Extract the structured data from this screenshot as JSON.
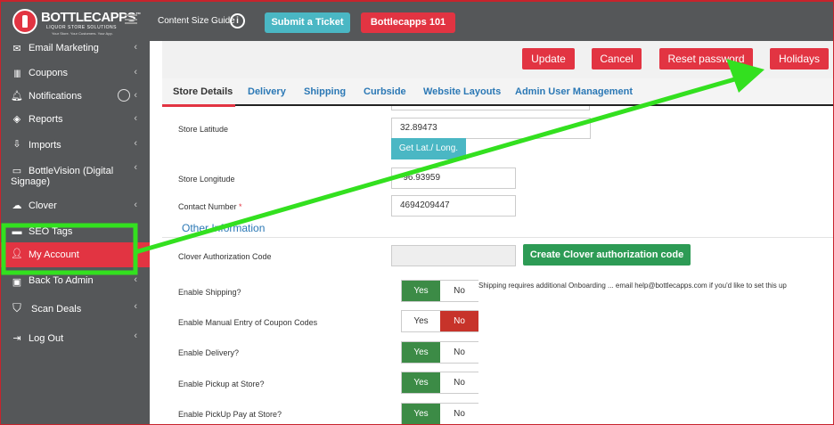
{
  "brand": {
    "name": "BOTTLECAPPS",
    "trademark": "™",
    "tagline": "LIQUOR STORE SOLUTIONS",
    "subtagline": "Your Store. Your Customers. Your App."
  },
  "topbar": {
    "content_size_guide": "Content Size Guide",
    "info": "i",
    "submit_ticket": "Submit a Ticket",
    "bottlecapps_101": "Bottlecapps 101"
  },
  "sidebar": {
    "items": [
      {
        "label": "Email Marketing",
        "icon": "envelope-icon"
      },
      {
        "label": "Coupons",
        "icon": "barcode-icon"
      },
      {
        "label": "Notifications",
        "icon": "bell-icon"
      },
      {
        "label": "Reports",
        "icon": "layers-icon"
      },
      {
        "label": "Imports",
        "icon": "import-icon"
      },
      {
        "label": "BottleVision (Digital Signage)",
        "icon": "monitor-icon"
      },
      {
        "label": "Clover",
        "icon": "cloud-icon"
      },
      {
        "label": "SEO Tags",
        "icon": "tag-icon"
      },
      {
        "label": "My Account",
        "icon": "user-icon"
      },
      {
        "label": "Back To Admin",
        "icon": "admin-icon"
      },
      {
        "label": "Scan Deals",
        "icon": "tags-icon"
      },
      {
        "label": "Log Out",
        "icon": "logout-icon"
      }
    ],
    "active": "My Account"
  },
  "actions": {
    "update": "Update",
    "cancel": "Cancel",
    "reset_password": "Reset password",
    "holidays": "Holidays"
  },
  "tabs": [
    "Store Details",
    "Delivery",
    "Shipping",
    "Curbside",
    "Website Layouts",
    "Admin User Management"
  ],
  "active_tab": "Store Details",
  "form": {
    "store_latitude_label": "Store Latitude",
    "store_latitude_value": "32.89473",
    "get_lat_long": "Get Lat./ Long.",
    "store_longitude_label": "Store Longitude",
    "store_longitude_value": "-96.93959",
    "contact_number_label": "Contact Number",
    "contact_number_required": "*",
    "contact_number_value": "4694209447",
    "other_information": "Other Information",
    "clover_auth_label": "Clover Authorization Code",
    "clover_auth_value": "",
    "create_clover_button": "Create Clover authorization code",
    "toggles": [
      {
        "label": "Enable Shipping?",
        "value": "Yes"
      },
      {
        "label": "Enable Manual Entry of Coupon Codes",
        "value": "No"
      },
      {
        "label": "Enable Delivery?",
        "value": "Yes"
      },
      {
        "label": "Enable Pickup at Store?",
        "value": "Yes"
      },
      {
        "label": "Enable PickUp Pay at Store?",
        "value": "Yes"
      }
    ],
    "yes": "Yes",
    "no": "No",
    "shipping_note": "Shipping requires additional Onboarding ... email help@bottlecapps.com if you'd like to set this up"
  },
  "colors": {
    "brand_red": "#e23442",
    "sidebar_bg": "#555759",
    "teal": "#4ab7c4",
    "green": "#2d9b55",
    "annotation_green": "#33e01f"
  }
}
